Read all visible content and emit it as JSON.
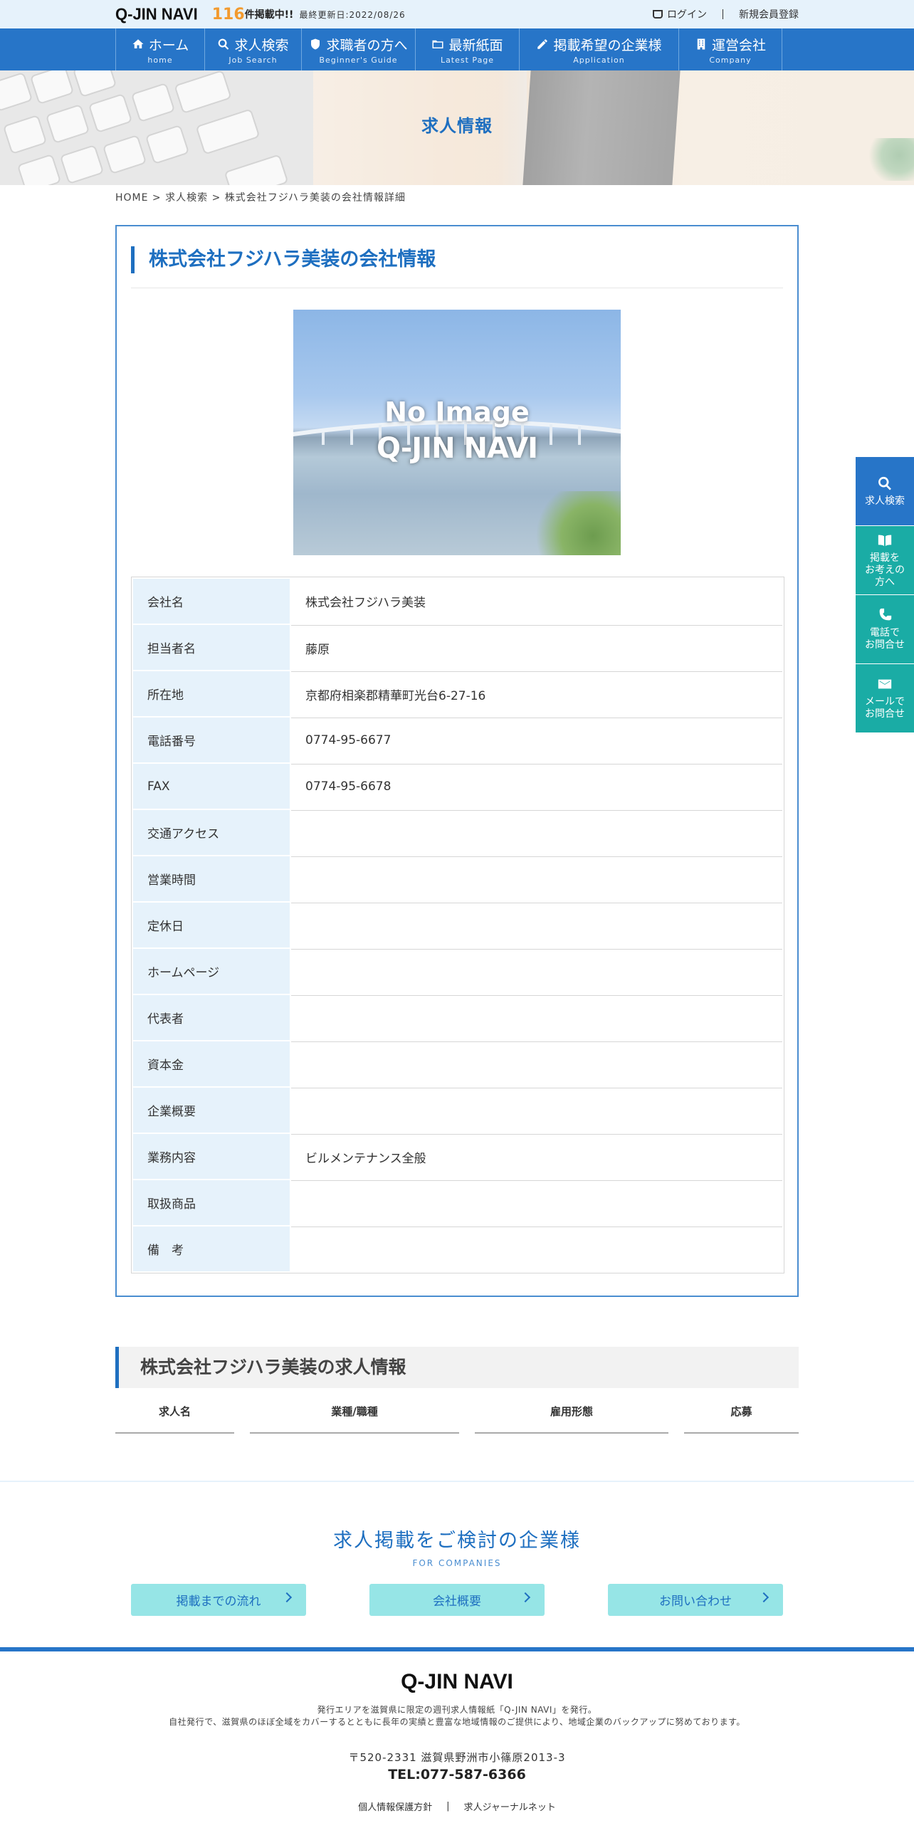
{
  "header": {
    "logo": "Q-JIN NAVI",
    "count": "116",
    "count_suffix": "件掲載中!!",
    "updated": "最終更新日:2022/08/26",
    "login": "ログイン",
    "register": "新規会員登録"
  },
  "nav": [
    {
      "label": "ホーム",
      "sub": "home",
      "icon": "home-icon"
    },
    {
      "label": "求人検索",
      "sub": "Job Search",
      "icon": "search-icon"
    },
    {
      "label": "求職者の方へ",
      "sub": "Beginner's Guide",
      "icon": "shield-icon"
    },
    {
      "label": "最新紙面",
      "sub": "Latest Page",
      "icon": "folder-icon"
    },
    {
      "label": "掲載希望の企業様",
      "sub": "Application",
      "icon": "pencil-icon"
    },
    {
      "label": "運営会社",
      "sub": "Company",
      "icon": "building-icon"
    }
  ],
  "hero": {
    "title": "求人情報"
  },
  "breadcrumb": {
    "home": "HOME",
    "sep": " > ",
    "search": "求人検索",
    "current": "株式会社フジハラ美装の会社情報詳細"
  },
  "company": {
    "title": "株式会社フジハラ美装の会社情報",
    "image_line1": "No Image",
    "image_line2": "Q-JIN NAVI",
    "rows": [
      {
        "key": "会社名",
        "value": "株式会社フジハラ美装"
      },
      {
        "key": "担当者名",
        "value": "藤原"
      },
      {
        "key": "所在地",
        "value": "京都府相楽郡精華町光台6-27-16"
      },
      {
        "key": "電話番号",
        "value": "0774-95-6677"
      },
      {
        "key": "FAX",
        "value": "0774-95-6678"
      },
      {
        "key": "交通アクセス",
        "value": ""
      },
      {
        "key": "営業時間",
        "value": ""
      },
      {
        "key": "定休日",
        "value": ""
      },
      {
        "key": "ホームページ",
        "value": ""
      },
      {
        "key": "代表者",
        "value": ""
      },
      {
        "key": "資本金",
        "value": ""
      },
      {
        "key": "企業概要",
        "value": ""
      },
      {
        "key": "業務内容",
        "value": "ビルメンテナンス全般"
      },
      {
        "key": "取扱商品",
        "value": ""
      },
      {
        "key": "備　考",
        "value": ""
      }
    ]
  },
  "jobs": {
    "title": "株式会社フジハラ美装の求人情報",
    "columns": [
      "求人名",
      "業種/職種",
      "雇用形態",
      "応募"
    ]
  },
  "for_companies": {
    "title": "求人掲載をご検討の企業様",
    "subtitle": "FOR COMPANIES",
    "buttons": [
      "掲載までの流れ",
      "会社概要",
      "お問い合わせ"
    ]
  },
  "footer": {
    "logo": "Q-JIN NAVI",
    "desc1": "発行エリアを滋賀県に限定の週刊求人情報紙「Q-JIN NAVI」を発行。",
    "desc2": "自社発行で、滋賀県のほぼ全域をカバーするとともに長年の実績と豊富な地域情報のご提供により、地域企業のバックアップに努めております。",
    "address": "〒520-2331 滋賀県野洲市小篠原2013-3",
    "tel": "TEL:077-587-6366",
    "link1": "個人情報保護方針",
    "link_sep": "|",
    "link2": "求人ジャーナルネット"
  },
  "side": [
    {
      "label": "求人検索",
      "icon": "search-icon",
      "color": "#2775c8"
    },
    {
      "label": "掲載を\nお考えの\n方へ",
      "icon": "book-icon",
      "color": "#1aaca5"
    },
    {
      "label": "電話で\nお問合せ",
      "icon": "phone-icon",
      "color": "#1aaca5"
    },
    {
      "label": "メールで\nお問合せ",
      "icon": "mail-icon",
      "color": "#1aaca5"
    }
  ],
  "colors": {
    "brand": "#2775c8",
    "accent": "#1e6fc0",
    "teal": "#1aaca5",
    "count": "#f29a2e",
    "button": "#96e5e6"
  }
}
